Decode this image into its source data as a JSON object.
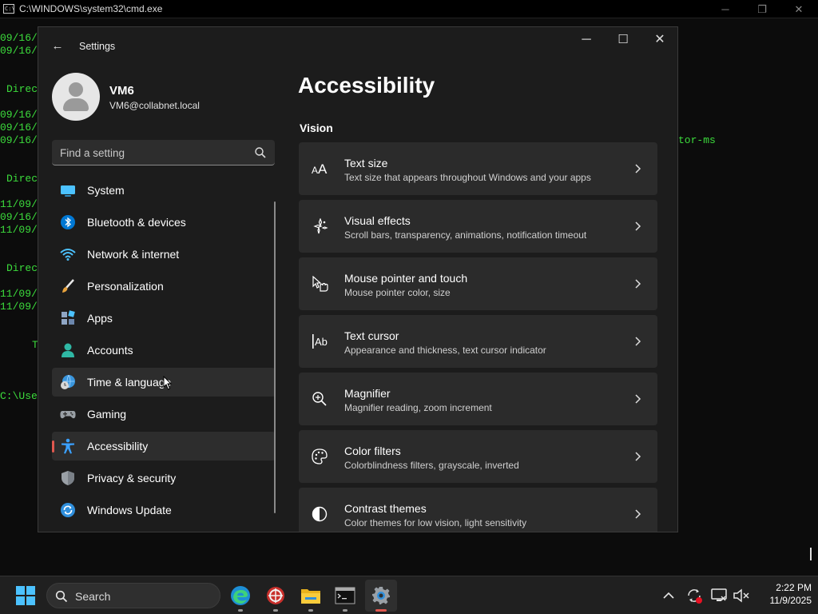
{
  "cmd": {
    "title": "C:\\WINDOWS\\system32\\cmd.exe",
    "icon_text": "C:\\",
    "lines": [
      "09/16/",
      "09/16/",
      "Direc",
      "09/16/",
      "09/16/",
      "09/16/",
      "Direc",
      "11/09/",
      "09/16/",
      "11/09/",
      "Direc",
      "11/09/",
      "11/09/",
      "T",
      "C:\\Use",
      "tor-ms"
    ],
    "controls": [
      "─",
      "❐",
      "✕"
    ]
  },
  "settings": {
    "title": "Settings",
    "back_glyph": "←",
    "controls": {
      "minimize": "─",
      "maximize": "☐",
      "close": "✕"
    },
    "user": {
      "name": "VM6",
      "email": "VM6@collabnet.local"
    },
    "search": {
      "placeholder": "Find a setting"
    },
    "nav": [
      {
        "label": "System",
        "icon": "system-icon",
        "color": "#4cc2ff"
      },
      {
        "label": "Bluetooth & devices",
        "icon": "bluetooth-icon",
        "color": "#0078d4"
      },
      {
        "label": "Network & internet",
        "icon": "wifi-icon",
        "color": "#4cc2ff"
      },
      {
        "label": "Personalization",
        "icon": "paintbrush-icon",
        "color": "#e8a33d"
      },
      {
        "label": "Apps",
        "icon": "apps-icon",
        "color": "#8fa6c4"
      },
      {
        "label": "Accounts",
        "icon": "accounts-icon",
        "color": "#2fb8a5"
      },
      {
        "label": "Time & language",
        "icon": "globe-clock-icon",
        "color": "#3a96dd"
      },
      {
        "label": "Gaming",
        "icon": "gamepad-icon",
        "color": "#9aa0a6"
      },
      {
        "label": "Accessibility",
        "icon": "accessibility-icon",
        "color": "#3aa0ff"
      },
      {
        "label": "Privacy & security",
        "icon": "shield-icon",
        "color": "#9aa0a6"
      },
      {
        "label": "Windows Update",
        "icon": "update-icon",
        "color": "#2f8fdc"
      }
    ],
    "selected_nav": "Accessibility",
    "hovered_nav": "Time & language",
    "page_title": "Accessibility",
    "section": "Vision",
    "cards": [
      {
        "title": "Text size",
        "subtitle": "Text size that appears throughout Windows and your apps",
        "icon": "text-size-icon"
      },
      {
        "title": "Visual effects",
        "subtitle": "Scroll bars, transparency, animations, notification timeout",
        "icon": "visual-effects-icon"
      },
      {
        "title": "Mouse pointer and touch",
        "subtitle": "Mouse pointer color, size",
        "icon": "mouse-pointer-icon"
      },
      {
        "title": "Text cursor",
        "subtitle": "Appearance and thickness, text cursor indicator",
        "icon": "text-cursor-icon"
      },
      {
        "title": "Magnifier",
        "subtitle": "Magnifier reading, zoom increment",
        "icon": "magnifier-icon"
      },
      {
        "title": "Color filters",
        "subtitle": "Colorblindness filters, grayscale, inverted",
        "icon": "color-filters-icon"
      },
      {
        "title": "Contrast themes",
        "subtitle": "Color themes for low vision, light sensitivity",
        "icon": "contrast-icon"
      }
    ]
  },
  "taskbar": {
    "search_label": "Search",
    "apps": [
      "start-icon",
      "edge-icon",
      "app-icon",
      "file-explorer-icon",
      "terminal-icon",
      "settings-gear-icon"
    ],
    "active_app": "settings-gear-icon",
    "time": "2:22 PM",
    "date": "11/9/2025",
    "accent": "#e0584f"
  }
}
